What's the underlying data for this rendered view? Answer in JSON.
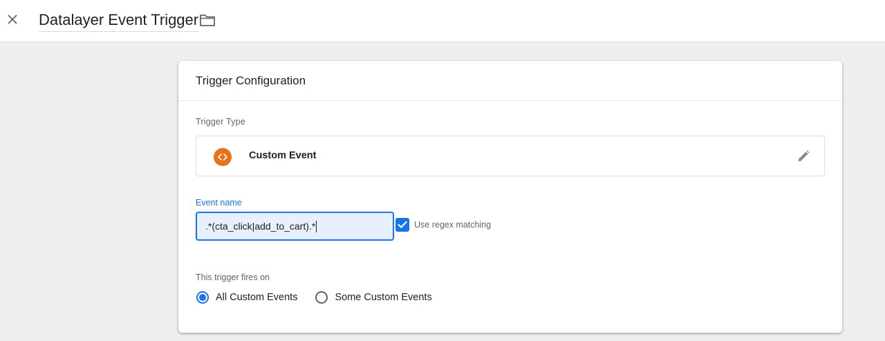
{
  "header": {
    "title": "Datalayer Event Trigger",
    "close_icon": "close-icon",
    "folder_icon": "folder-icon"
  },
  "card": {
    "title": "Trigger Configuration",
    "trigger_type_label": "Trigger Type",
    "trigger_type": {
      "name": "Custom Event",
      "icon": "code-brackets-icon",
      "icon_color": "#e8711c",
      "edit_icon": "pencil-icon"
    },
    "event_name": {
      "label": "Event name",
      "value": ".*(cta_click|add_to_cart).*"
    },
    "regex": {
      "label": "Use regex matching",
      "checked": true
    },
    "fires_on": {
      "label": "This trigger fires on",
      "options": [
        {
          "label": "All Custom Events",
          "selected": true
        },
        {
          "label": "Some Custom Events",
          "selected": false
        }
      ]
    }
  },
  "colors": {
    "accent": "#1a73e8",
    "background": "#efefef"
  }
}
